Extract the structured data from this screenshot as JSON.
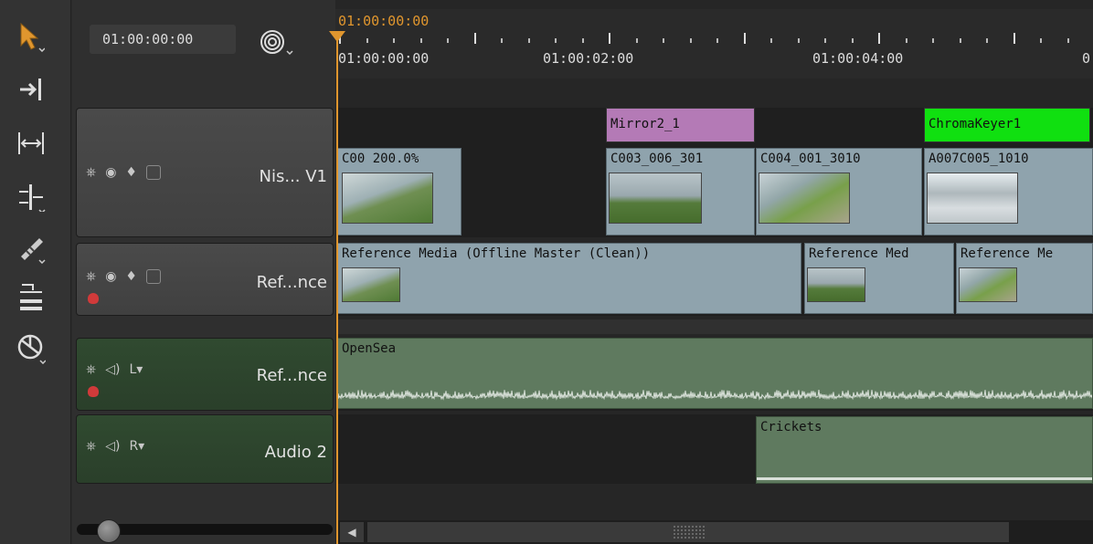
{
  "timecode": "01:00:00:00",
  "playhead": {
    "label": "01:00:00:00"
  },
  "ruler": {
    "labels": [
      "01:00:00:00",
      "01:00:02:00",
      "01:00:04:00",
      "0"
    ]
  },
  "tracks": {
    "v1": {
      "name": "Nis... V1"
    },
    "ref_video": {
      "name": "Ref...nce"
    },
    "ref_audio": {
      "name": "Ref...nce",
      "channel": "L"
    },
    "audio2": {
      "name": "Audio 2",
      "channel": "R"
    }
  },
  "effects": [
    {
      "label": "Mirror2_1",
      "color": "#b47ab6"
    },
    {
      "label": "ChromaKeyer1",
      "color": "#10e010"
    }
  ],
  "v1_clips": [
    "C00 200.0%",
    "C003_006_301",
    "C004_001_3010",
    "A007C005_1010"
  ],
  "ref_clips": [
    "Reference Media (Offline Master (Clean))",
    "Reference Med",
    "Reference Me"
  ],
  "audio_clips": {
    "opensea": "OpenSea",
    "crickets": "Crickets"
  },
  "icons": [
    "select-arrow-icon",
    "track-select-icon",
    "slip-icon",
    "slide-icon",
    "razor-icon",
    "ripple-icon",
    "retime-icon",
    "snap-icon",
    "lock-icon",
    "eye-icon",
    "layers-icon",
    "blend-icon",
    "speaker-icon"
  ],
  "colors": {
    "playhead": "#e0962e",
    "video_clip": "#8fa3ad",
    "audio_clip": "#5f7a5f"
  }
}
